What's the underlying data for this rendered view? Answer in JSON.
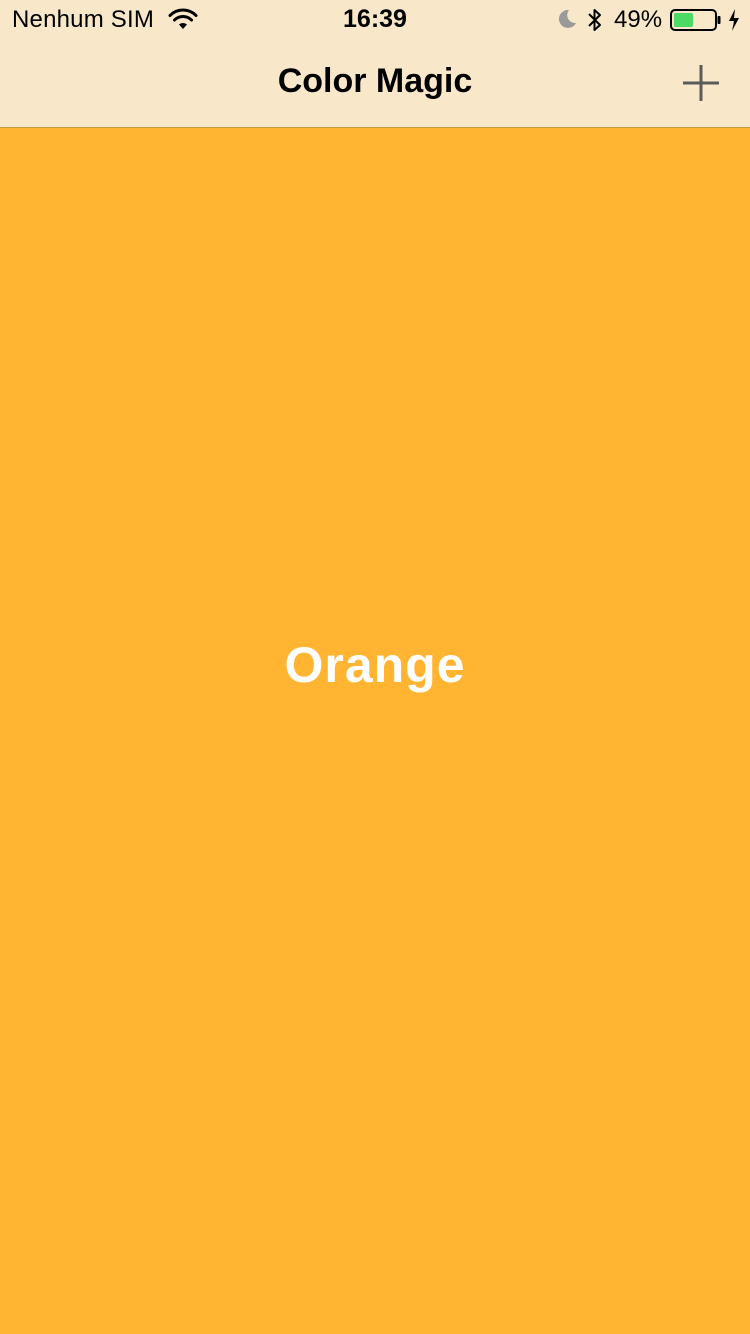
{
  "status_bar": {
    "carrier": "Nenhum SIM",
    "time": "16:39",
    "battery_percent": "49%",
    "battery_level": 0.49,
    "icons": [
      "wifi-icon",
      "moon-icon",
      "bluetooth-icon",
      "battery-icon",
      "charging-bolt-icon"
    ]
  },
  "nav": {
    "title": "Color Magic",
    "add_icon": "plus-icon"
  },
  "main": {
    "color_name": "Orange",
    "background_color": "#FFB532"
  },
  "colors": {
    "nav_background": "#F8E8C9",
    "battery_fill": "#4CD964"
  }
}
